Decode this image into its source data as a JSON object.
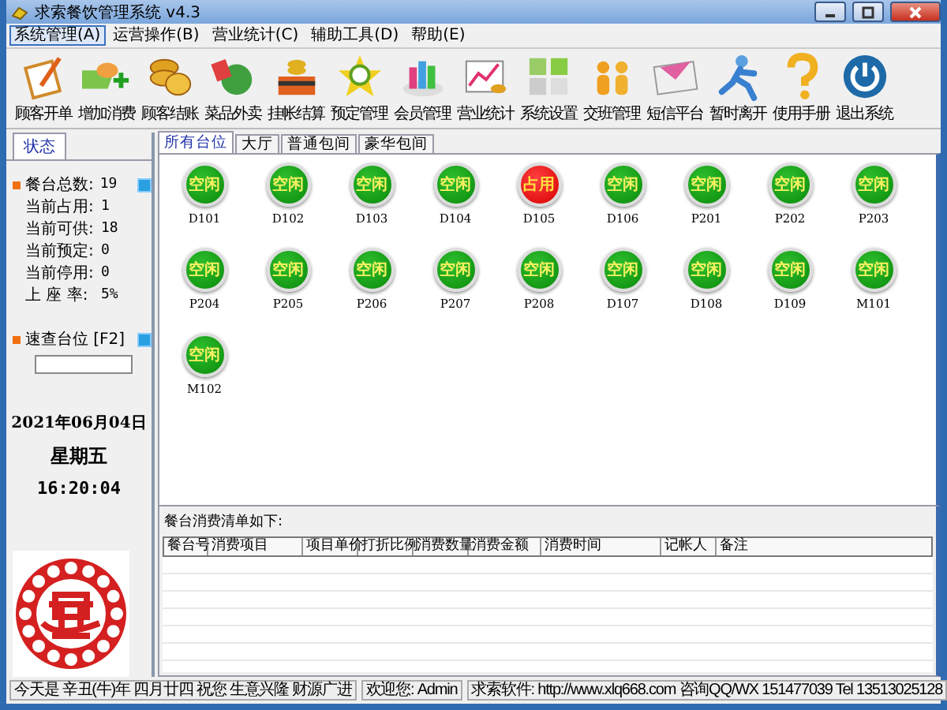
{
  "window": {
    "title": "求索餐饮管理系统 v4.3"
  },
  "menu": [
    {
      "label": "系统管理(A)",
      "selected": true
    },
    {
      "label": "运营操作(B)",
      "selected": false
    },
    {
      "label": "营业统计(C)",
      "selected": false
    },
    {
      "label": "辅助工具(D)",
      "selected": false
    },
    {
      "label": "帮助(E)",
      "selected": false
    }
  ],
  "toolbar": [
    "顾客开单",
    "增加消费",
    "顾客结账",
    "菜品外卖",
    "挂帐结算",
    "预定管理",
    "会员管理",
    "营业统计",
    "系统设置",
    "交班管理",
    "短信平台",
    "暂时离开",
    "使用手册",
    "退出系统"
  ],
  "left_panel": {
    "tab": "状态",
    "stats": [
      {
        "kind": "header",
        "label": "餐台总数:",
        "value": "19"
      },
      {
        "kind": "item",
        "label": "当前占用:",
        "value": "1"
      },
      {
        "kind": "item",
        "label": "当前可供:",
        "value": "18"
      },
      {
        "kind": "item",
        "label": "当前预定:",
        "value": "0"
      },
      {
        "kind": "item",
        "label": "当前停用:",
        "value": "0"
      },
      {
        "kind": "item",
        "label": "上 座 率:",
        "value": "5%"
      }
    ],
    "lookup": {
      "label": "速查台位 [F2]"
    },
    "date": "2021年06月04日",
    "weekday": "星期五",
    "time": "16:20:04"
  },
  "tabs": [
    {
      "label": "所有台位",
      "selected": true
    },
    {
      "label": "大厅",
      "selected": false
    },
    {
      "label": "普通包间",
      "selected": false
    },
    {
      "label": "豪华包间",
      "selected": false
    }
  ],
  "tables": [
    {
      "name": "D101",
      "status": "空闲",
      "kind": "free"
    },
    {
      "name": "D102",
      "status": "空闲",
      "kind": "free"
    },
    {
      "name": "D103",
      "status": "空闲",
      "kind": "free"
    },
    {
      "name": "D104",
      "status": "空闲",
      "kind": "free"
    },
    {
      "name": "D105",
      "status": "占用",
      "kind": "occupied"
    },
    {
      "name": "D106",
      "status": "空闲",
      "kind": "free"
    },
    {
      "name": "P201",
      "status": "空闲",
      "kind": "free"
    },
    {
      "name": "P202",
      "status": "空闲",
      "kind": "free"
    },
    {
      "name": "P203",
      "status": "空闲",
      "kind": "free"
    },
    {
      "name": "P204",
      "status": "空闲",
      "kind": "free"
    },
    {
      "name": "P205",
      "status": "空闲",
      "kind": "free"
    },
    {
      "name": "P206",
      "status": "空闲",
      "kind": "free"
    },
    {
      "name": "P207",
      "status": "空闲",
      "kind": "free"
    },
    {
      "name": "P208",
      "status": "空闲",
      "kind": "free"
    },
    {
      "name": "D107",
      "status": "空闲",
      "kind": "free"
    },
    {
      "name": "D108",
      "status": "空闲",
      "kind": "free"
    },
    {
      "name": "D109",
      "status": "空闲",
      "kind": "free"
    },
    {
      "name": "M101",
      "status": "空闲",
      "kind": "free"
    },
    {
      "name": "M102",
      "status": "空闲",
      "kind": "free"
    }
  ],
  "order_list": {
    "title": "餐台消费清单如下:",
    "columns": [
      "餐台号",
      "消费项目",
      "项目单价",
      "打折比例",
      "消费数量",
      "消费金额",
      "消费时间",
      "记帐人",
      "备注"
    ]
  },
  "status_bar": [
    "今天是 辛丑(牛)年 四月廿四 祝您 生意兴隆 财源广进",
    "欢迎您: Admin",
    "求索软件: http://www.xlq668.com  咨询QQ/WX 151477039  Tel 13513025128"
  ]
}
